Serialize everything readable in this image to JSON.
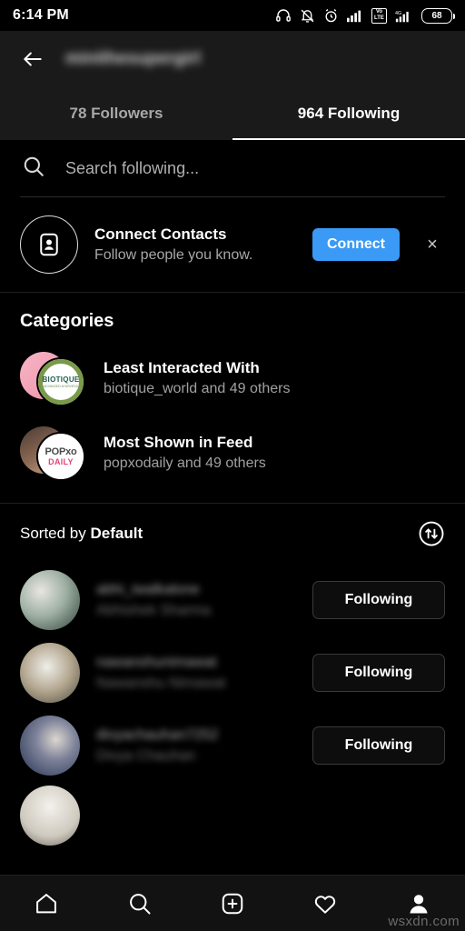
{
  "status_bar": {
    "time": "6:14 PM",
    "battery_level": "68",
    "network_label_top": "Vo",
    "network_label_bottom": "LTE",
    "data_label": "4G",
    "icons": [
      "headphones-icon",
      "bell-off-icon",
      "alarm-icon",
      "signal-bars-icon",
      "volte-icon",
      "signal-bars-4g-icon",
      "battery-icon"
    ]
  },
  "header": {
    "back_label": "back-arrow",
    "username": "minithesupergirl",
    "tabs": [
      {
        "label": "78 Followers",
        "active": false
      },
      {
        "label": "964 Following",
        "active": true
      }
    ]
  },
  "search": {
    "placeholder": "Search following...",
    "value": ""
  },
  "connect_contacts": {
    "title": "Connect Contacts",
    "subtitle": "Follow people you know.",
    "button_label": "Connect",
    "button_color": "#3a9af5",
    "dismiss_label": "×"
  },
  "categories": {
    "heading": "Categories",
    "items": [
      {
        "title": "Least Interacted With",
        "subtitle": "biotique_world and 49 others",
        "avatar_front": "biotique-logo",
        "avatar_front_text_top": "BIOTIQUE",
        "avatar_front_text_bottom": "ADVANCED AYURVEDA",
        "avatar_back_color": "#f4a9bd"
      },
      {
        "title": "Most Shown in Feed",
        "subtitle": "popxodaily and 49 others",
        "avatar_front": "popxo-logo",
        "avatar_front_text_top": "POPxo",
        "avatar_front_text_bottom": "DAILY",
        "avatar_back_color": "#6b4a3c"
      }
    ]
  },
  "sort": {
    "prefix": "Sorted by ",
    "value": "Default",
    "icon": "sort-arrows-icon"
  },
  "user_list": [
    {
      "handle": "abhi_iwalkalone",
      "name": "Abhishek Sharma",
      "button_label": "Following",
      "avatar_color": "#9fb0a4"
    },
    {
      "handle": "nawanshunimawat",
      "name": "Nawanshu Nimawat",
      "button_label": "Following",
      "avatar_color": "#b3a68f"
    },
    {
      "handle": "divyachauhan7252",
      "name": "Divya Chauhan",
      "button_label": "Following",
      "avatar_color": "#4a5e84"
    }
  ],
  "bottom_nav": [
    {
      "icon": "home-icon",
      "active": false
    },
    {
      "icon": "search-icon",
      "active": false
    },
    {
      "icon": "add-post-icon",
      "active": false
    },
    {
      "icon": "heart-icon",
      "active": false
    },
    {
      "icon": "profile-icon",
      "active": true
    }
  ],
  "watermark": "wsxdn.com"
}
